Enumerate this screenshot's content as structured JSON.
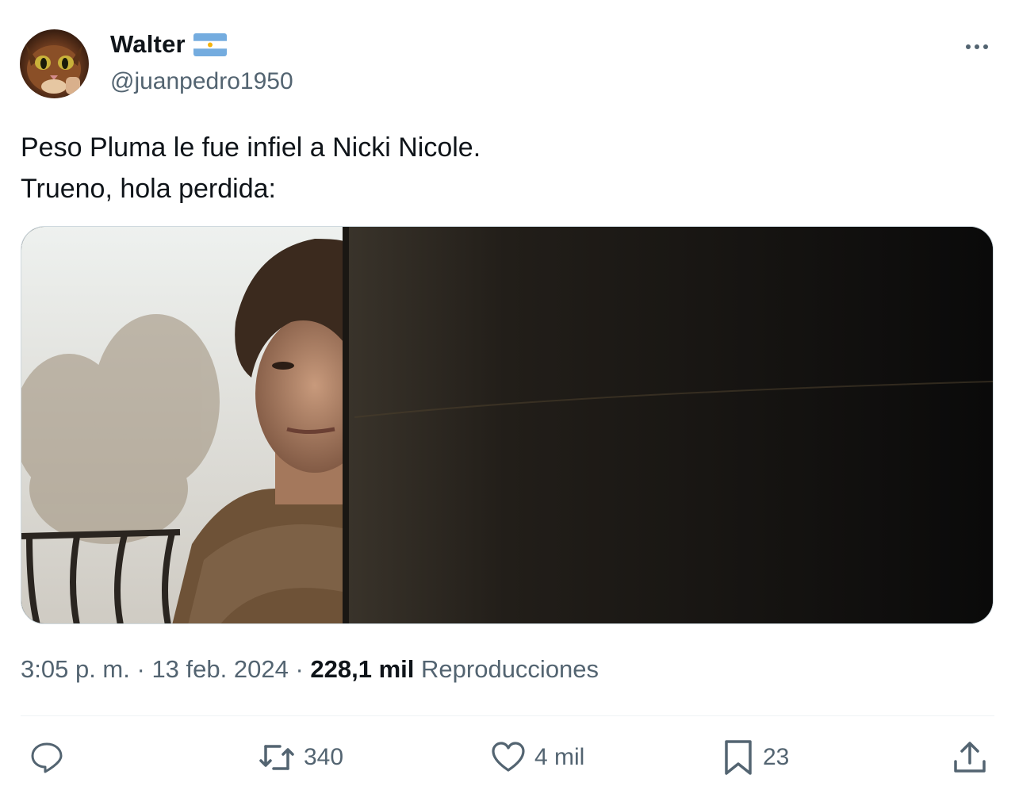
{
  "author": {
    "display_name": "Walter",
    "handle": "@juanpedro1950",
    "avatar_icon": "cat-avatar-icon",
    "badge_icon": "argentina-flag-icon"
  },
  "tweet": {
    "lines": [
      "Peso Pluma le fue infiel a Nicki Nicole.",
      "Trueno, hola perdida:"
    ]
  },
  "meta": {
    "time": "3:05 p. m.",
    "separator": "·",
    "date": "13 feb. 2024",
    "views_count": "228,1 mil",
    "views_label": "Reproducciones"
  },
  "actions": {
    "reply": {
      "icon": "reply-icon",
      "count": ""
    },
    "retweet": {
      "icon": "retweet-icon",
      "count": "340"
    },
    "like": {
      "icon": "heart-icon",
      "count": "4 mil"
    },
    "bookmark": {
      "icon": "bookmark-icon",
      "count": "23"
    },
    "share": {
      "icon": "share-icon"
    }
  },
  "colors": {
    "text_primary": "#0f1419",
    "text_secondary": "#536471",
    "divider": "#eff3f4",
    "flag_blue": "#74acdf",
    "flag_sun": "#f6b40e"
  }
}
